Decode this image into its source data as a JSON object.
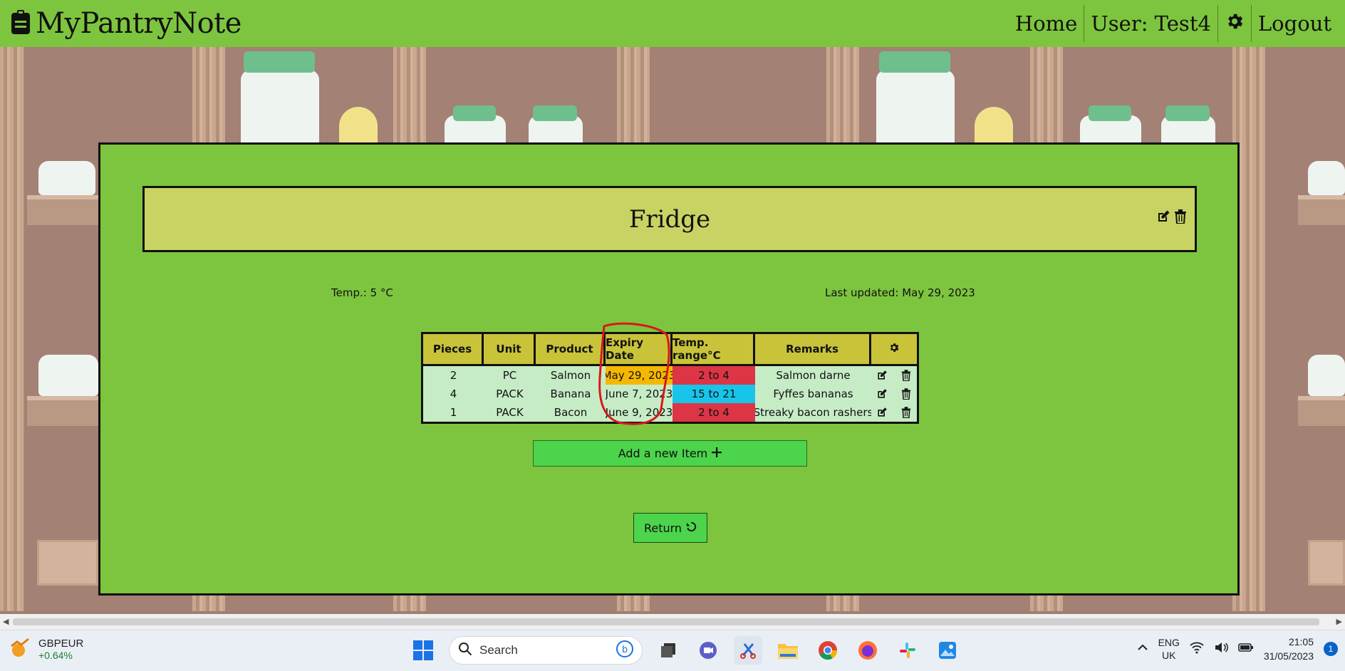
{
  "app": {
    "brand": "MyPantryNote",
    "nav": {
      "home": "Home",
      "user": "User: Test4",
      "logout": "Logout"
    }
  },
  "storage": {
    "name": "Fridge",
    "temperature": "Temp.: 5 °C",
    "last_updated": "Last updated: May 29, 2023"
  },
  "table": {
    "headers": {
      "pieces": "Pieces",
      "unit": "Unit",
      "product": "Product",
      "expiry": "Expiry Date",
      "temp": "Temp. range°C",
      "remarks": "Remarks"
    },
    "rows": [
      {
        "pieces": "2",
        "unit": "PC",
        "product": "Salmon",
        "expiry": "May 29, 2023",
        "temp": "2 to 4",
        "remarks": "Salmon darne"
      },
      {
        "pieces": "4",
        "unit": "PACK",
        "product": "Banana",
        "expiry": "June 7, 2023",
        "temp": "15 to 21",
        "remarks": "Fyffes bananas"
      },
      {
        "pieces": "1",
        "unit": "PACK",
        "product": "Bacon",
        "expiry": "June 9, 2023",
        "temp": "2 to 4",
        "remarks": "Streaky bacon rashers"
      }
    ],
    "colors": {
      "expiry_warning": "#f5b800",
      "temp_cold": "#dc3545",
      "temp_warm": "#17c5ea"
    }
  },
  "buttons": {
    "add_item": "Add a new Item",
    "return": "Return"
  },
  "taskbar": {
    "ticker_name": "GBPEUR",
    "ticker_change": "+0.64%",
    "search_placeholder": "Search",
    "lang_1": "ENG",
    "lang_2": "UK",
    "time": "21:05",
    "date": "31/05/2023",
    "notification_count": "1"
  }
}
